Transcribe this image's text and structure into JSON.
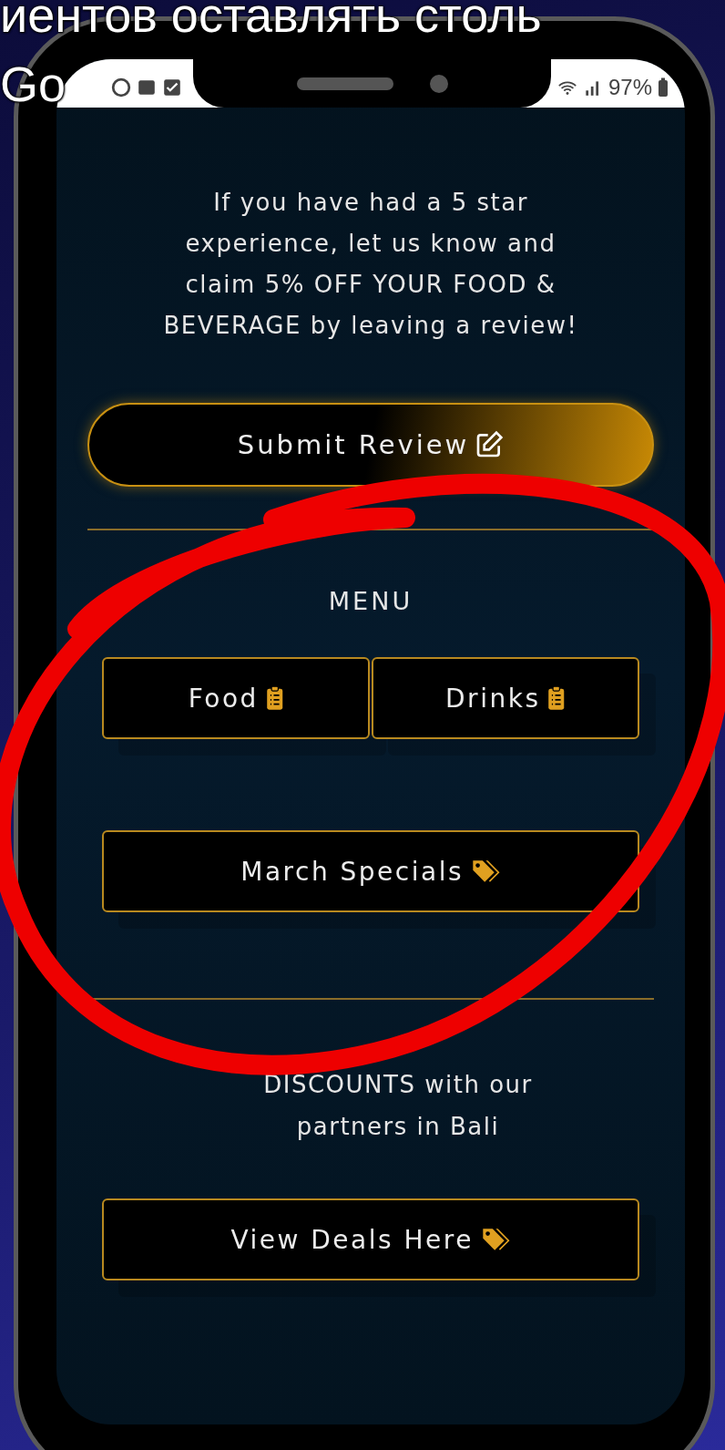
{
  "background_heading": {
    "lines": [
      "иентов оставлять столь",
      "Go"
    ]
  },
  "status_bar": {
    "battery": "97%"
  },
  "intro": "If you have had a 5 star experience, let us know and claim 5% OFF YOUR FOOD & BEVERAGE by leaving a review!",
  "review_button": {
    "label": "Submit Review",
    "kind": "edit"
  },
  "menu": {
    "title": "MENU",
    "rows": [
      [
        {
          "label": "Food",
          "kind": "clipboard"
        },
        {
          "label": "Drinks",
          "kind": "clipboard"
        }
      ],
      [
        {
          "label": "March Specials",
          "kind": "tags"
        }
      ]
    ]
  },
  "partners": {
    "text": "DISCOUNTS with our partners in Bali"
  },
  "deals_button": {
    "label": "View Deals Here",
    "kind": "tags"
  }
}
